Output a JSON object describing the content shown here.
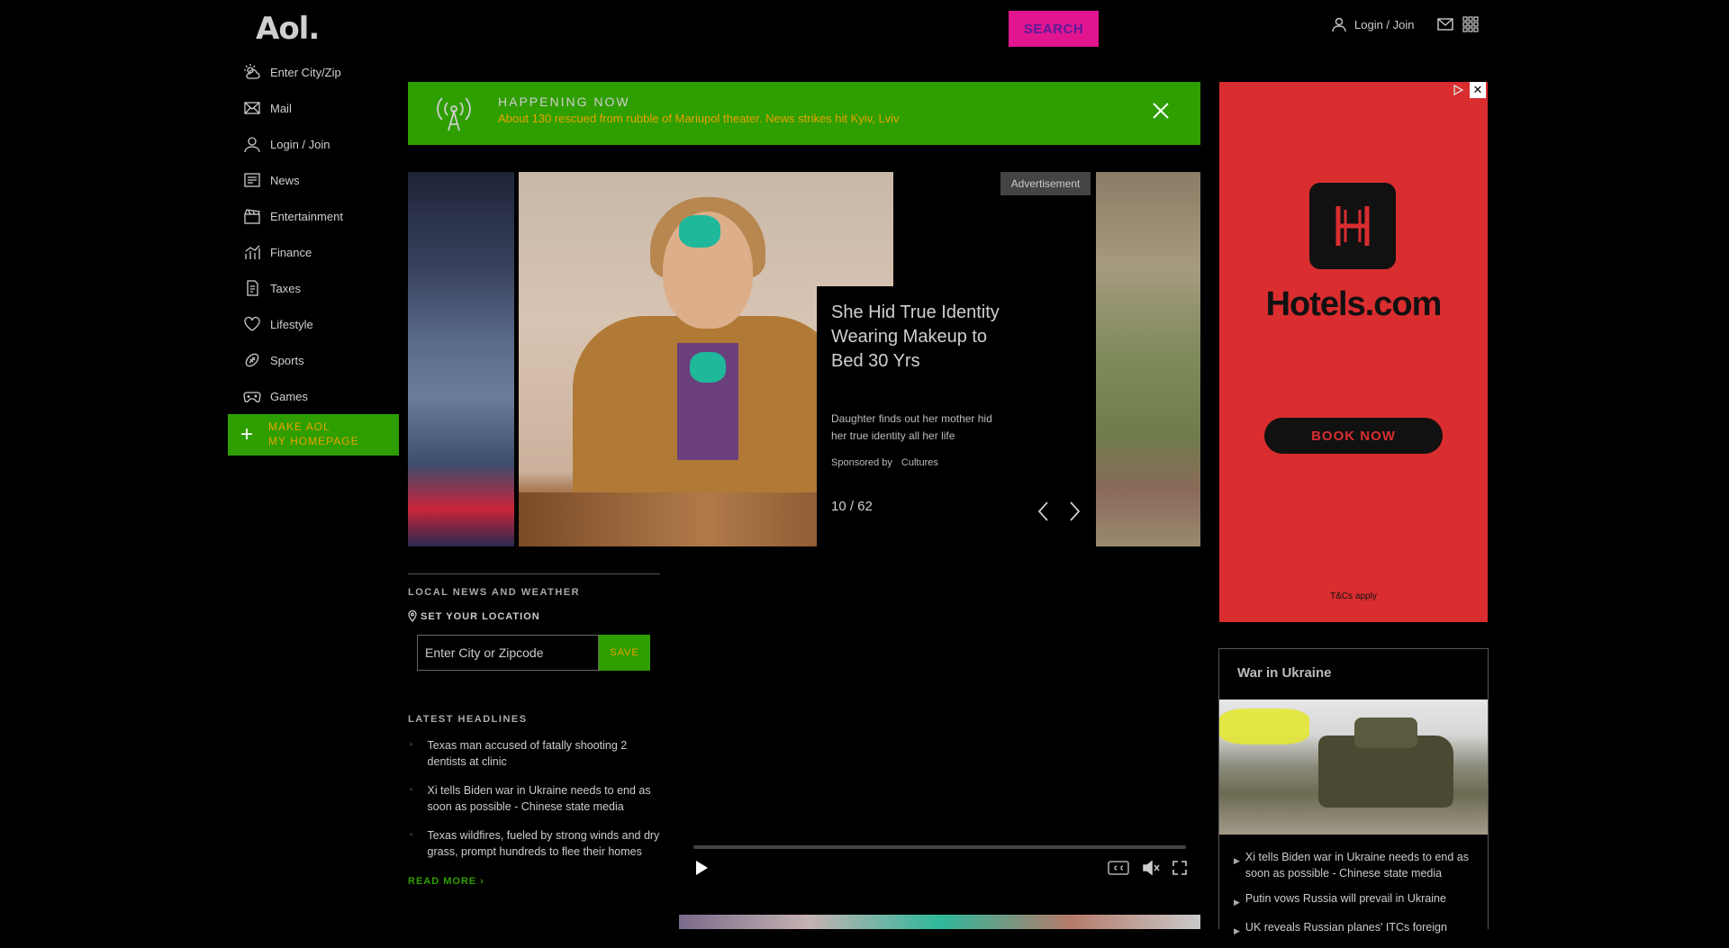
{
  "header": {
    "logo": "Aol.",
    "search_label": "SEARCH",
    "login_label": "Login / Join"
  },
  "sidebar": {
    "items": [
      {
        "label": "Enter City/Zip",
        "icon": "weather-icon"
      },
      {
        "label": "Mail",
        "icon": "mail-icon"
      },
      {
        "label": "Login / Join",
        "icon": "user-icon"
      },
      {
        "label": "News",
        "icon": "news-icon"
      },
      {
        "label": "Entertainment",
        "icon": "clapper-icon"
      },
      {
        "label": "Finance",
        "icon": "chart-icon"
      },
      {
        "label": "Taxes",
        "icon": "tax-icon"
      },
      {
        "label": "Lifestyle",
        "icon": "heart-icon"
      },
      {
        "label": "Sports",
        "icon": "football-icon"
      },
      {
        "label": "Games",
        "icon": "gamepad-icon"
      }
    ],
    "make_home_line1": "MAKE AOL",
    "make_home_line2": "MY HOMEPAGE"
  },
  "happening": {
    "title": "HAPPENING NOW",
    "text": "About 130 rescued from rubble of Mariupol theater. News strikes hit Kyiv, Lviv"
  },
  "carousel": {
    "ad_badge": "Advertisement",
    "title": "She Hid True Identity Wearing Makeup to Bed 30 Yrs",
    "description": "Daughter finds out her mother hid her true identity all her life",
    "sponsored_by": "Sponsored by",
    "sponsor": "Cultures",
    "count": "10 / 62"
  },
  "local": {
    "label": "LOCAL NEWS AND WEATHER",
    "set_location": "SET YOUR LOCATION",
    "input_placeholder": "Enter City or Zipcode",
    "save_label": "SAVE"
  },
  "headlines": {
    "label": "LATEST HEADLINES",
    "items": [
      "Texas man accused of fatally shooting 2 dentists at clinic",
      "Xi tells Biden war in Ukraine needs to end as soon as possible - Chinese state media",
      "Texas wildfires, fueled by strong winds and dry grass, prompt hundreds to flee their homes"
    ],
    "read_more": "READ MORE ›"
  },
  "ad": {
    "brand": "Hotels.com",
    "cta": "BOOK NOW",
    "footer": "T&Cs apply"
  },
  "ukraine": {
    "title": "War in Ukraine",
    "items": [
      "Xi tells Biden war in Ukraine needs to end as soon as possible - Chinese state media",
      "Putin vows Russia will prevail in Ukraine",
      "UK reveals Russian planes' ITCs foreign"
    ]
  },
  "colors": {
    "accent_green": "#2f9e00",
    "search_pink": "#e0158f",
    "ad_red": "#d92d2f",
    "link_orange": "#e8a200"
  }
}
